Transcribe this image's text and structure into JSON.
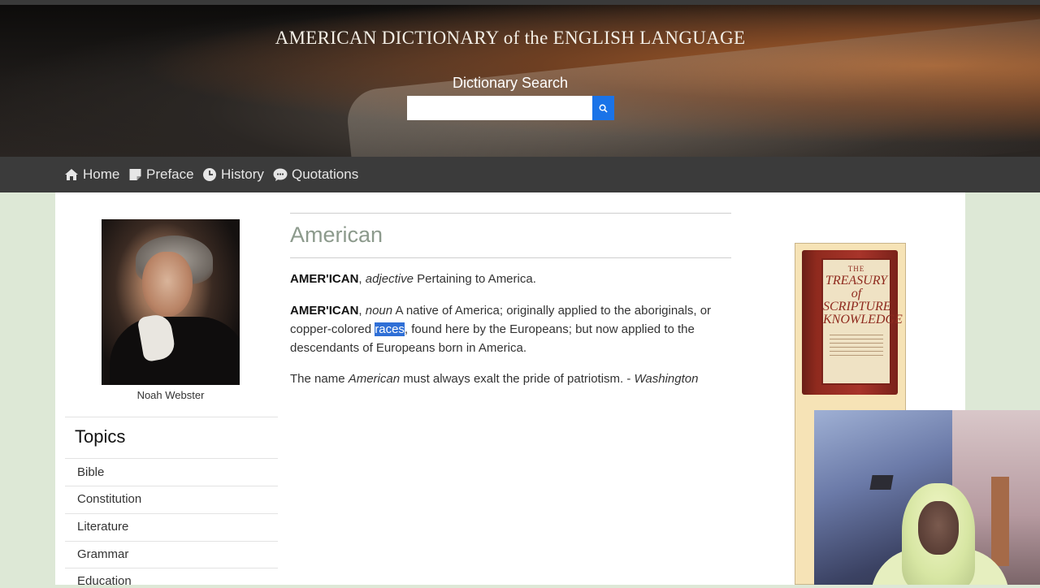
{
  "header": {
    "title": "AMERICAN DICTIONARY of the ENGLISH LANGUAGE",
    "search_label": "Dictionary Search",
    "search_value": "",
    "search_icon": "search-icon"
  },
  "nav": {
    "items": [
      {
        "label": "Home",
        "icon": "home-icon"
      },
      {
        "label": "Preface",
        "icon": "document-icon"
      },
      {
        "label": "History",
        "icon": "clock-icon"
      },
      {
        "label": "Quotations",
        "icon": "speech-bubble-icon"
      }
    ]
  },
  "sidebar": {
    "portrait_caption": "Noah Webster",
    "topics_heading": "Topics",
    "topics": [
      "Bible",
      "Constitution",
      "Literature",
      "Grammar",
      "Education"
    ]
  },
  "entry": {
    "word": "American",
    "def1": {
      "headword": "AMER'ICAN",
      "pos": "adjective",
      "text": "Pertaining to America."
    },
    "def2": {
      "headword": "AMER'ICAN",
      "pos": "noun",
      "text_before": "A native of America; originally applied to the aboriginals, or copper-colored",
      "highlighted": "races",
      "text_after": ", found here by the Europeans; but now applied to the descendants of Europeans born in America."
    },
    "quote": {
      "before": "The name",
      "italic_word": "American",
      "after": "must always exalt the pride of patriotism. -",
      "author": "Washington"
    }
  },
  "ad": {
    "book_line1": "THE",
    "book_title": "TREASURY of SCRIPTURE KNOWLEDGE"
  },
  "colors": {
    "nav_bg": "#3b3b3b",
    "page_bg": "#dde8d6",
    "search_button": "#1a73e8",
    "title_accent": "#8c9a8c",
    "selection": "#2f6fd6"
  }
}
